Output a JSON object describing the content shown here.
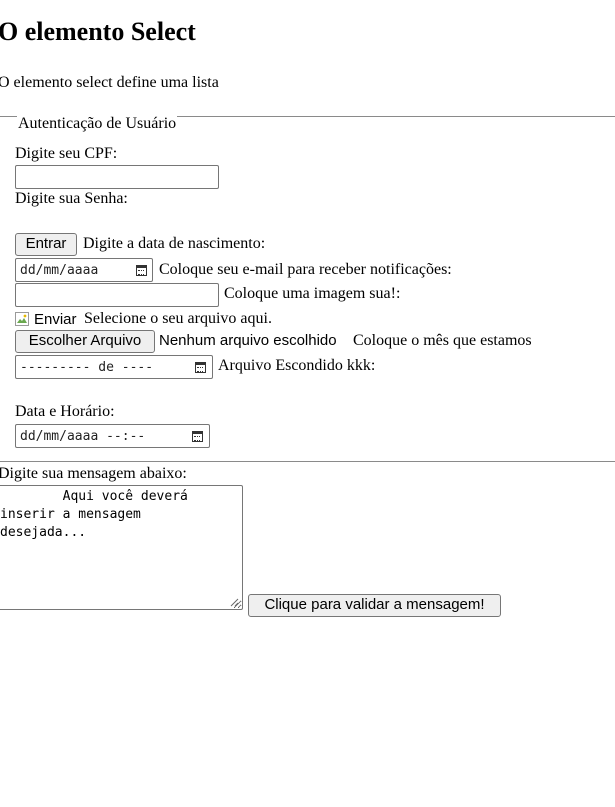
{
  "page": {
    "title": "O elemento Select",
    "intro": "O elemento select define uma lista"
  },
  "form": {
    "legend": "Autenticação de Usuário",
    "cpf_label": "Digite seu CPF:",
    "cpf_value": "",
    "password_label": "Digite sua Senha:",
    "submit_label": "Entrar",
    "birthdate_label": "Digite a data de nascimento:",
    "birthdate_placeholder": "dd/mm/aaaa",
    "email_label": "Coloque seu e-mail para receber notificações:",
    "email_value": "",
    "image_label": "Coloque uma imagem sua!:",
    "image_alt": "Enviar",
    "file_label": "Selecione o seu arquivo aqui.",
    "file_button": "Escolher Arquivo",
    "file_status": "Nenhum arquivo escolhido",
    "month_label": "Coloque o mês que estamos",
    "month_placeholder": "--------- de ----",
    "hidden_label": "Arquivo Escondido kkk:",
    "datetime_label": "Data e Horário:",
    "datetime_placeholder": "dd/mm/aaaa --:--"
  },
  "message": {
    "label": "Digite sua mensagem abaixo:",
    "text": "        Aqui você deverá\ninserir a mensagem\ndesejada...",
    "validate_button": "Clique para validar a mensagem!"
  },
  "icons": {
    "calendar": "calendar-icon",
    "broken_image": "broken-image-icon",
    "resize": "resize-grip-icon"
  }
}
